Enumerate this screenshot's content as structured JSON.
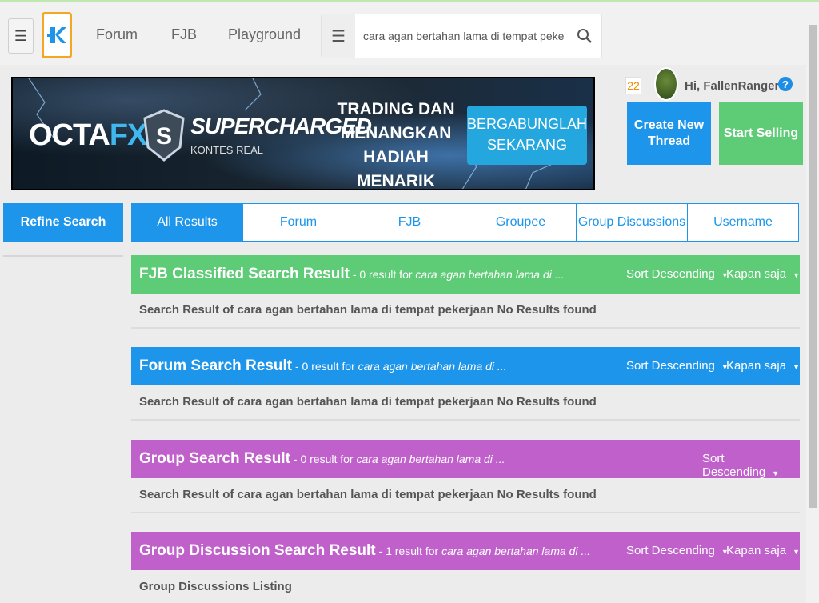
{
  "nav": {
    "menu_icon": "hamburger-icon",
    "logo_icon": "kaskus-logo-icon",
    "links": [
      "Forum",
      "FJB",
      "Playground"
    ]
  },
  "search": {
    "value": "cara agan bertahan lama di tempat pekerjaan",
    "menu_icon": "list-icon",
    "icon": "search-icon"
  },
  "banner": {
    "brand_left": "OCTA",
    "brand_right": "FX",
    "headline": "SUPERCHARGED",
    "subheadline": "KONTES REAL",
    "promo": "TRADING DAN MENANGKAN HADIAH MENARIK",
    "cta": "BERGABUNGLAH SEKARANG"
  },
  "user": {
    "notification_count": "22",
    "greeting": "Hi, FallenRangers",
    "help": "?"
  },
  "actions": {
    "create_thread": "Create New Thread",
    "start_selling": "Start Selling"
  },
  "refine_search": "Refine Search",
  "tabs": [
    "All Results",
    "Forum",
    "FJB",
    "Groupee",
    "Group Discussions",
    "Username"
  ],
  "sections": [
    {
      "title": "FJB Classified Search Result",
      "count": " - 0 result for ",
      "query": "cara agan bertahan lama di ...",
      "sort": "Sort Descending",
      "time": "Kapan saja",
      "body": "Search Result of cara agan bertahan lama di tempat pekerjaan No Results found",
      "color": "#5ecb77"
    },
    {
      "title": "Forum Search Result",
      "count": " - 0 result for ",
      "query": "cara agan bertahan lama di ...",
      "sort": "Sort Descending",
      "time": "Kapan saja",
      "body": "Search Result of cara agan bertahan lama di tempat pekerjaan No Results found",
      "color": "#1c95ea"
    },
    {
      "title": "Group Search Result",
      "count": " - 0 result for ",
      "query": "cara agan bertahan lama di ...",
      "sort": "Sort Descending",
      "body": "Search Result of cara agan bertahan lama di tempat pekerjaan No Results found",
      "color": "#c061cb"
    },
    {
      "title": "Group Discussion Search Result",
      "count": " - 1 result for ",
      "query": "cara agan bertahan lama di ...",
      "sort": "Sort Descending",
      "time": "Kapan saja",
      "body": "Group Discussions Listing",
      "color": "#c061cb"
    }
  ]
}
